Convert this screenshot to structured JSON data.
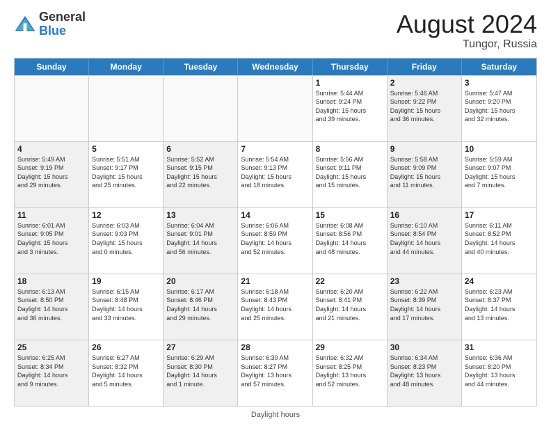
{
  "header": {
    "logo_general": "General",
    "logo_blue": "Blue",
    "month_title": "August 2024",
    "location": "Tungor, Russia"
  },
  "footer": {
    "daylight_label": "Daylight hours"
  },
  "weekdays": [
    "Sunday",
    "Monday",
    "Tuesday",
    "Wednesday",
    "Thursday",
    "Friday",
    "Saturday"
  ],
  "rows": [
    [
      {
        "day": "",
        "info": "",
        "shaded": false,
        "empty": true
      },
      {
        "day": "",
        "info": "",
        "shaded": false,
        "empty": true
      },
      {
        "day": "",
        "info": "",
        "shaded": false,
        "empty": true
      },
      {
        "day": "",
        "info": "",
        "shaded": false,
        "empty": true
      },
      {
        "day": "1",
        "info": "Sunrise: 5:44 AM\nSunset: 9:24 PM\nDaylight: 15 hours\nand 39 minutes.",
        "shaded": false
      },
      {
        "day": "2",
        "info": "Sunrise: 5:46 AM\nSunset: 9:22 PM\nDaylight: 15 hours\nand 36 minutes.",
        "shaded": true
      },
      {
        "day": "3",
        "info": "Sunrise: 5:47 AM\nSunset: 9:20 PM\nDaylight: 15 hours\nand 32 minutes.",
        "shaded": false
      }
    ],
    [
      {
        "day": "4",
        "info": "Sunrise: 5:49 AM\nSunset: 9:19 PM\nDaylight: 15 hours\nand 29 minutes.",
        "shaded": true
      },
      {
        "day": "5",
        "info": "Sunrise: 5:51 AM\nSunset: 9:17 PM\nDaylight: 15 hours\nand 25 minutes.",
        "shaded": false
      },
      {
        "day": "6",
        "info": "Sunrise: 5:52 AM\nSunset: 9:15 PM\nDaylight: 15 hours\nand 22 minutes.",
        "shaded": true
      },
      {
        "day": "7",
        "info": "Sunrise: 5:54 AM\nSunset: 9:13 PM\nDaylight: 15 hours\nand 18 minutes.",
        "shaded": false
      },
      {
        "day": "8",
        "info": "Sunrise: 5:56 AM\nSunset: 9:11 PM\nDaylight: 15 hours\nand 15 minutes.",
        "shaded": false
      },
      {
        "day": "9",
        "info": "Sunrise: 5:58 AM\nSunset: 9:09 PM\nDaylight: 15 hours\nand 11 minutes.",
        "shaded": true
      },
      {
        "day": "10",
        "info": "Sunrise: 5:59 AM\nSunset: 9:07 PM\nDaylight: 15 hours\nand 7 minutes.",
        "shaded": false
      }
    ],
    [
      {
        "day": "11",
        "info": "Sunrise: 6:01 AM\nSunset: 9:05 PM\nDaylight: 15 hours\nand 3 minutes.",
        "shaded": true
      },
      {
        "day": "12",
        "info": "Sunrise: 6:03 AM\nSunset: 9:03 PM\nDaylight: 15 hours\nand 0 minutes.",
        "shaded": false
      },
      {
        "day": "13",
        "info": "Sunrise: 6:04 AM\nSunset: 9:01 PM\nDaylight: 14 hours\nand 56 minutes.",
        "shaded": true
      },
      {
        "day": "14",
        "info": "Sunrise: 6:06 AM\nSunset: 8:59 PM\nDaylight: 14 hours\nand 52 minutes.",
        "shaded": false
      },
      {
        "day": "15",
        "info": "Sunrise: 6:08 AM\nSunset: 8:56 PM\nDaylight: 14 hours\nand 48 minutes.",
        "shaded": false
      },
      {
        "day": "16",
        "info": "Sunrise: 6:10 AM\nSunset: 8:54 PM\nDaylight: 14 hours\nand 44 minutes.",
        "shaded": true
      },
      {
        "day": "17",
        "info": "Sunrise: 6:11 AM\nSunset: 8:52 PM\nDaylight: 14 hours\nand 40 minutes.",
        "shaded": false
      }
    ],
    [
      {
        "day": "18",
        "info": "Sunrise: 6:13 AM\nSunset: 8:50 PM\nDaylight: 14 hours\nand 36 minutes.",
        "shaded": true
      },
      {
        "day": "19",
        "info": "Sunrise: 6:15 AM\nSunset: 8:48 PM\nDaylight: 14 hours\nand 33 minutes.",
        "shaded": false
      },
      {
        "day": "20",
        "info": "Sunrise: 6:17 AM\nSunset: 8:46 PM\nDaylight: 14 hours\nand 29 minutes.",
        "shaded": true
      },
      {
        "day": "21",
        "info": "Sunrise: 6:18 AM\nSunset: 8:43 PM\nDaylight: 14 hours\nand 25 minutes.",
        "shaded": false
      },
      {
        "day": "22",
        "info": "Sunrise: 6:20 AM\nSunset: 8:41 PM\nDaylight: 14 hours\nand 21 minutes.",
        "shaded": false
      },
      {
        "day": "23",
        "info": "Sunrise: 6:22 AM\nSunset: 8:39 PM\nDaylight: 14 hours\nand 17 minutes.",
        "shaded": true
      },
      {
        "day": "24",
        "info": "Sunrise: 6:23 AM\nSunset: 8:37 PM\nDaylight: 14 hours\nand 13 minutes.",
        "shaded": false
      }
    ],
    [
      {
        "day": "25",
        "info": "Sunrise: 6:25 AM\nSunset: 8:34 PM\nDaylight: 14 hours\nand 9 minutes.",
        "shaded": true
      },
      {
        "day": "26",
        "info": "Sunrise: 6:27 AM\nSunset: 8:32 PM\nDaylight: 14 hours\nand 5 minutes.",
        "shaded": false
      },
      {
        "day": "27",
        "info": "Sunrise: 6:29 AM\nSunset: 8:30 PM\nDaylight: 14 hours\nand 1 minute.",
        "shaded": true
      },
      {
        "day": "28",
        "info": "Sunrise: 6:30 AM\nSunset: 8:27 PM\nDaylight: 13 hours\nand 57 minutes.",
        "shaded": false
      },
      {
        "day": "29",
        "info": "Sunrise: 6:32 AM\nSunset: 8:25 PM\nDaylight: 13 hours\nand 52 minutes.",
        "shaded": false
      },
      {
        "day": "30",
        "info": "Sunrise: 6:34 AM\nSunset: 8:23 PM\nDaylight: 13 hours\nand 48 minutes.",
        "shaded": true
      },
      {
        "day": "31",
        "info": "Sunrise: 6:36 AM\nSunset: 8:20 PM\nDaylight: 13 hours\nand 44 minutes.",
        "shaded": false
      }
    ]
  ]
}
